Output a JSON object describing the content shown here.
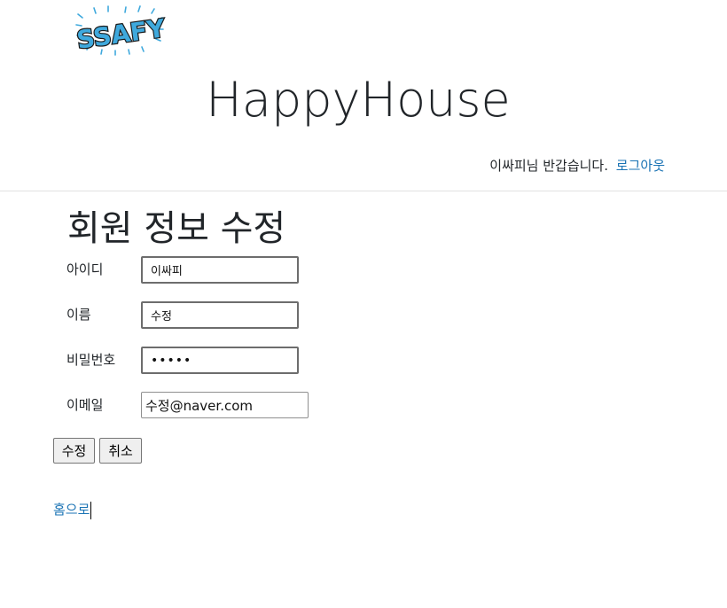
{
  "header": {
    "logo_text": "SSAFY",
    "app_title": "HappyHouse",
    "greeting": "이싸피님 반갑습니다.",
    "logout_label": "로그아웃"
  },
  "form": {
    "heading": "회원 정보 수정",
    "fields": [
      {
        "label": "아이디",
        "value": "이싸피",
        "type": "text"
      },
      {
        "label": "이름",
        "value": "수정",
        "type": "text"
      },
      {
        "label": "비밀번호",
        "value": "12345",
        "type": "password"
      },
      {
        "label": "이메일",
        "value": "수정@naver.com",
        "type": "email"
      }
    ],
    "submit_label": "수정",
    "cancel_label": "취소"
  },
  "footer": {
    "home_link_label": "홈으로"
  },
  "colors": {
    "link": "#1a73b4",
    "logo_fill": "#3fa9dd",
    "logo_outline": "#1b1b1b",
    "divider": "#e2e2e2"
  }
}
